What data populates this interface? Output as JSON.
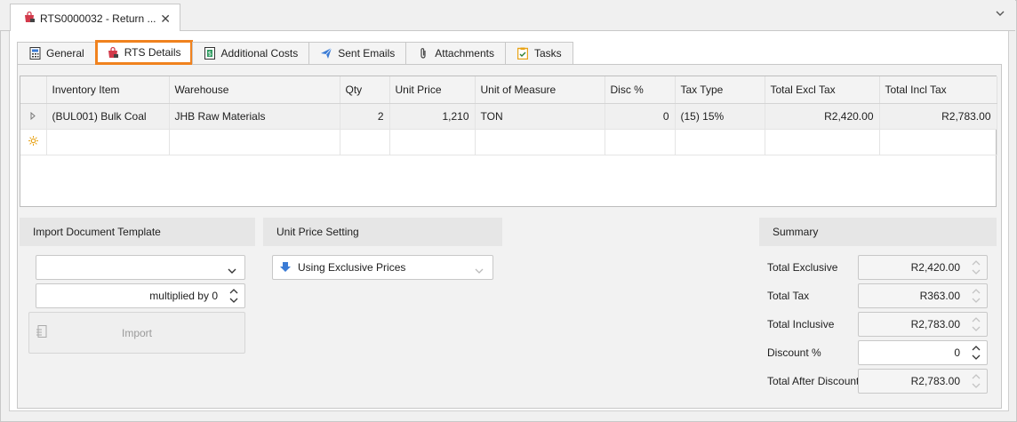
{
  "document_tab": {
    "title": "RTS0000032 - Return ...",
    "close": "✕"
  },
  "tabs": [
    {
      "label": "General",
      "icon": "calculator-icon"
    },
    {
      "label": "RTS Details",
      "icon": "shopping-bag-icon"
    },
    {
      "label": "Additional Costs",
      "icon": "dollar-doc-icon"
    },
    {
      "label": "Sent Emails",
      "icon": "send-icon"
    },
    {
      "label": "Attachments",
      "icon": "paperclip-icon"
    },
    {
      "label": "Tasks",
      "icon": "clipboard-check-icon"
    }
  ],
  "grid": {
    "columns": [
      "Inventory Item",
      "Warehouse",
      "Qty",
      "Unit Price",
      "Unit of Measure",
      "Disc %",
      "Tax Type",
      "Total Excl Tax",
      "Total Incl Tax"
    ],
    "rows": [
      [
        "(BUL001) Bulk Coal",
        "JHB Raw Materials",
        "2",
        "1,210",
        "TON",
        "0",
        "(15) 15%",
        "R2,420.00",
        "R2,783.00"
      ]
    ]
  },
  "import_template": {
    "header": "Import Document Template",
    "template_value": "",
    "multiplier": "multiplied by 0",
    "import_label": "Import"
  },
  "unit_price": {
    "header": "Unit Price Setting",
    "value": "Using Exclusive Prices"
  },
  "summary": {
    "header": "Summary",
    "total_exclusive_label": "Total Exclusive",
    "total_exclusive": "R2,420.00",
    "total_tax_label": "Total Tax",
    "total_tax": "R363.00",
    "total_inclusive_label": "Total Inclusive",
    "total_inclusive": "R2,783.00",
    "discount_label": "Discount %",
    "discount": "0",
    "after_discount_label": "Total After Discount",
    "after_discount": "R2,783.00"
  },
  "colors": {
    "accent": "#f0821e",
    "icon_blue": "#3a7bd5",
    "bag_red": "#d23a4b"
  }
}
